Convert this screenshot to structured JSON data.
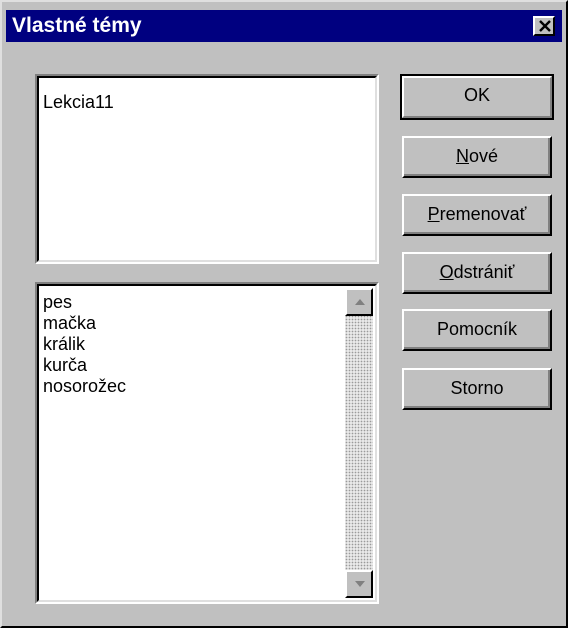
{
  "window": {
    "title": "Vlastné témy"
  },
  "topics_list": {
    "items": [
      "Lekcia11"
    ]
  },
  "words_list": {
    "items": [
      "pes",
      "mačka",
      "králik",
      "kurča",
      "nosorožec"
    ]
  },
  "buttons": {
    "ok": "OK",
    "new": {
      "mnemonic": "N",
      "rest": "ové"
    },
    "rename": {
      "mnemonic": "P",
      "rest": "remenovať"
    },
    "delete": {
      "mnemonic": "O",
      "rest": "dstrániť"
    },
    "helper": "Pomocník",
    "cancel": "Storno"
  },
  "icons": {
    "close": "close-icon",
    "scroll_up": "scroll-up-arrow-icon",
    "scroll_down": "scroll-down-arrow-icon"
  },
  "colors": {
    "titlebar": "#000080",
    "face": "#c0c0c0"
  }
}
